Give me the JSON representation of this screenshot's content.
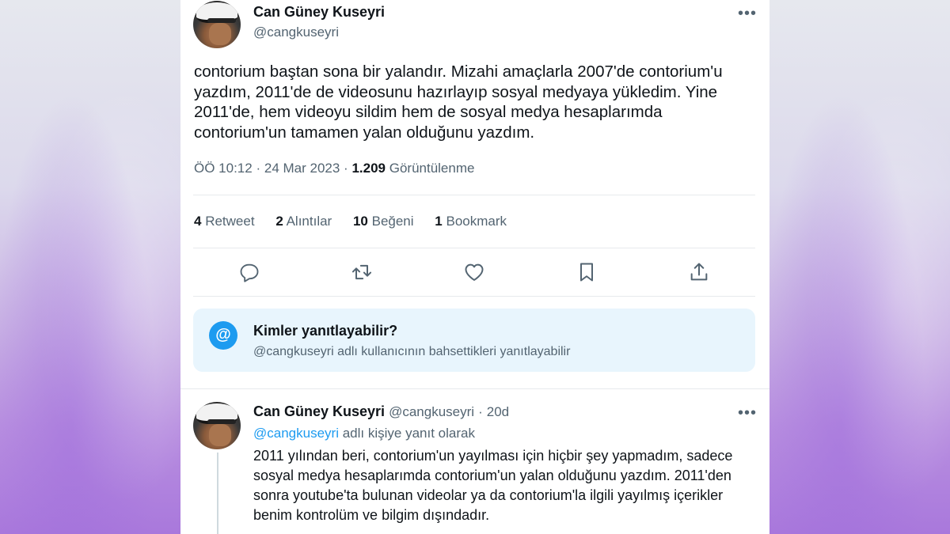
{
  "tweet": {
    "author_name": "Can Güney Kuseyri",
    "author_handle": "@cangkuseyri",
    "more_glyph": "•••",
    "text": "contorium baştan sona bir yalandır. Mizahi amaçlarla 2007'de contorium'u yazdım, 2011'de de videosunu hazırlayıp sosyal medyaya yükledim. Yine 2011'de, hem videoyu sildim hem de sosyal medya hesaplarımda contorium'un tamamen yalan olduğunu yazdım.",
    "time": "ÖÖ 10:12",
    "date": "24 Mar 2023",
    "separator": "·",
    "views_count": "1.209",
    "views_label": "Görüntülenme"
  },
  "stats": {
    "retweets_count": "4",
    "retweets_label": "Retweet",
    "quotes_count": "2",
    "quotes_label": "Alıntılar",
    "likes_count": "10",
    "likes_label": "Beğeni",
    "bookmarks_count": "1",
    "bookmarks_label": "Bookmark"
  },
  "actions": {
    "icons": [
      "reply-icon",
      "retweet-icon",
      "like-icon",
      "bookmark-icon",
      "share-icon"
    ]
  },
  "reply_settings": {
    "icon_glyph": "@",
    "title": "Kimler yanıtlayabilir?",
    "subtitle": "@cangkuseyri adlı kullanıcının bahsettikleri yanıtlayabilir"
  },
  "reply": {
    "author_name": "Can Güney Kuseyri",
    "author_handle": "@cangkuseyri",
    "separator": "·",
    "age": "20d",
    "more_glyph": "•••",
    "reply_to_mention": "@cangkuseyri",
    "reply_to_suffix": "adlı kişiye yanıt olarak",
    "text": "2011 yılından beri, contorium'un yayılması için hiçbir şey yapmadım, sadece sosyal medya hesaplarımda contorium'un yalan olduğunu yazdım. 2011'den sonra youtube'ta bulunan videolar ya da contorium'la ilgili yayılmış içerikler benim kontrolüm ve bilgim dışındadır."
  },
  "colors": {
    "accent": "#1d9bf0",
    "text_primary": "#0f1419",
    "text_secondary": "#536471",
    "info_box_bg": "#e8f5fd"
  }
}
